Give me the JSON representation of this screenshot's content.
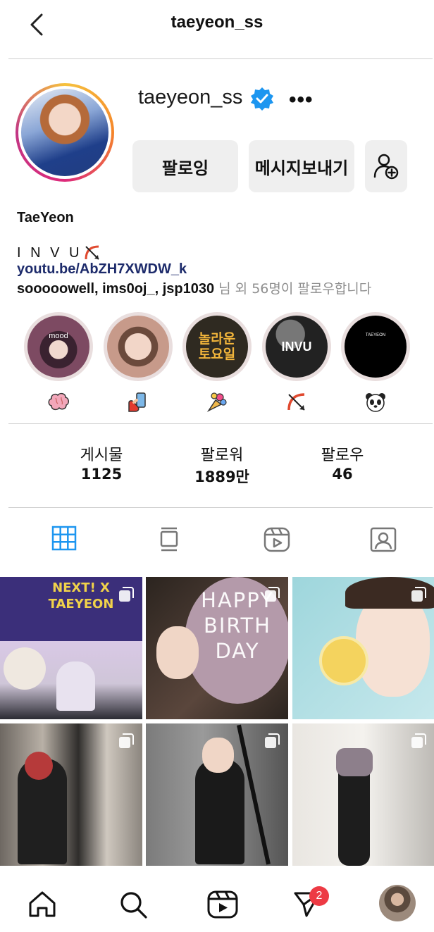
{
  "header": {
    "title": "taeyeon_ss",
    "back_icon": "chevron-left-icon"
  },
  "profile": {
    "username": "taeyeon_ss",
    "verified_icon": "verified-badge-icon",
    "more_icon": "more-horizontal-icon",
    "more_label": "•••",
    "follow_button": "팔로잉",
    "message_button": "메시지보내기",
    "add_friend_icon": "add-person-icon",
    "display_name": "TaeYeon",
    "bio": "I N V U",
    "bio_icon": "bow-and-arrow-icon",
    "link": "youtu.be/AbZH7XWDW_k",
    "followed_by_names": "sooooowell, ims0oj_, jsp1030",
    "followed_by_rest": " 님 외 56명이 팔로우합니다"
  },
  "highlights": [
    {
      "cover_text": "mood",
      "emoji": "🧠",
      "cover_color": "#7d4a62"
    },
    {
      "cover_text": "",
      "emoji": "🤳",
      "cover_color": "#c79a8a"
    },
    {
      "cover_text": "놀라운 토요일",
      "emoji": "💐",
      "cover_color": "#2f2a21"
    },
    {
      "cover_text": "INVU",
      "emoji": "🏹",
      "cover_color": "#222222"
    },
    {
      "cover_text": "TAEYEON",
      "emoji": "🐼",
      "cover_color": "#000000"
    }
  ],
  "stats": [
    {
      "label": "게시물",
      "value": "1125"
    },
    {
      "label": "팔로워",
      "value": "1889만"
    },
    {
      "label": "팔로우",
      "value": "46"
    }
  ],
  "tabs": [
    {
      "icon": "grid-icon",
      "active": true
    },
    {
      "icon": "feed-list-icon",
      "active": false
    },
    {
      "icon": "reels-icon",
      "active": false
    },
    {
      "icon": "tagged-person-icon",
      "active": false
    }
  ],
  "posts": [
    {
      "overlay_text": "NEXT! X TAEYEON",
      "multi": true,
      "colors": [
        "#3b2f7a",
        "#d9c8e6"
      ]
    },
    {
      "overlay_text": "HAPPY BIRTH DAY",
      "multi": true,
      "colors": [
        "#2b241f",
        "#b49aaa"
      ]
    },
    {
      "overlay_text": "",
      "multi": true,
      "colors": [
        "#9ed6dc",
        "#e8f1f2"
      ]
    },
    {
      "overlay_text": "",
      "multi": true,
      "colors": [
        "#3d3a38",
        "#cfc8bf"
      ]
    },
    {
      "overlay_text": "",
      "multi": true,
      "colors": [
        "#6f6f6f",
        "#2a2a2a"
      ]
    },
    {
      "overlay_text": "",
      "multi": true,
      "colors": [
        "#e9e6e1",
        "#8a8a8a"
      ]
    }
  ],
  "bottom_nav": [
    {
      "icon": "home-icon"
    },
    {
      "icon": "search-icon"
    },
    {
      "icon": "reels-icon"
    },
    {
      "icon": "send-icon",
      "badge": "2"
    },
    {
      "icon": "profile-avatar-icon"
    }
  ],
  "colors": {
    "accent": "#1d96f0",
    "link": "#1d2b6b",
    "badge": "#ed3a44"
  }
}
